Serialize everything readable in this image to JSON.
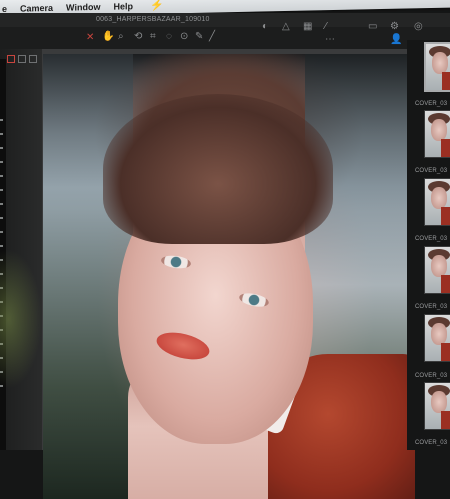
{
  "menubar": {
    "items": [
      "e",
      "Camera",
      "Window",
      "Help"
    ],
    "extra_icon": "bolt-icon"
  },
  "window": {
    "filename": "0063_HARPERSBAZAAR_109010"
  },
  "toolbar": {
    "tools": [
      "select-icon",
      "pan-icon",
      "zoom-icon",
      "rotate-icon",
      "crop-icon",
      "straighten-icon",
      "keystone-icon",
      "spot-removal-icon",
      "picker-icon"
    ],
    "right_tools": [
      "exposure-icon",
      "warning-icon",
      "grid-icon",
      "eyedropper-icon",
      "guides-icon",
      "proof-icon",
      "settings-icon",
      "user-icon"
    ]
  },
  "thumbnails": {
    "labels": [
      "COVER_03",
      "COVER_03",
      "COVER_03",
      "COVER_03",
      "COVER_03",
      "COVER_03"
    ]
  },
  "colors": {
    "accent": "#c8453e",
    "background": "#151616"
  }
}
